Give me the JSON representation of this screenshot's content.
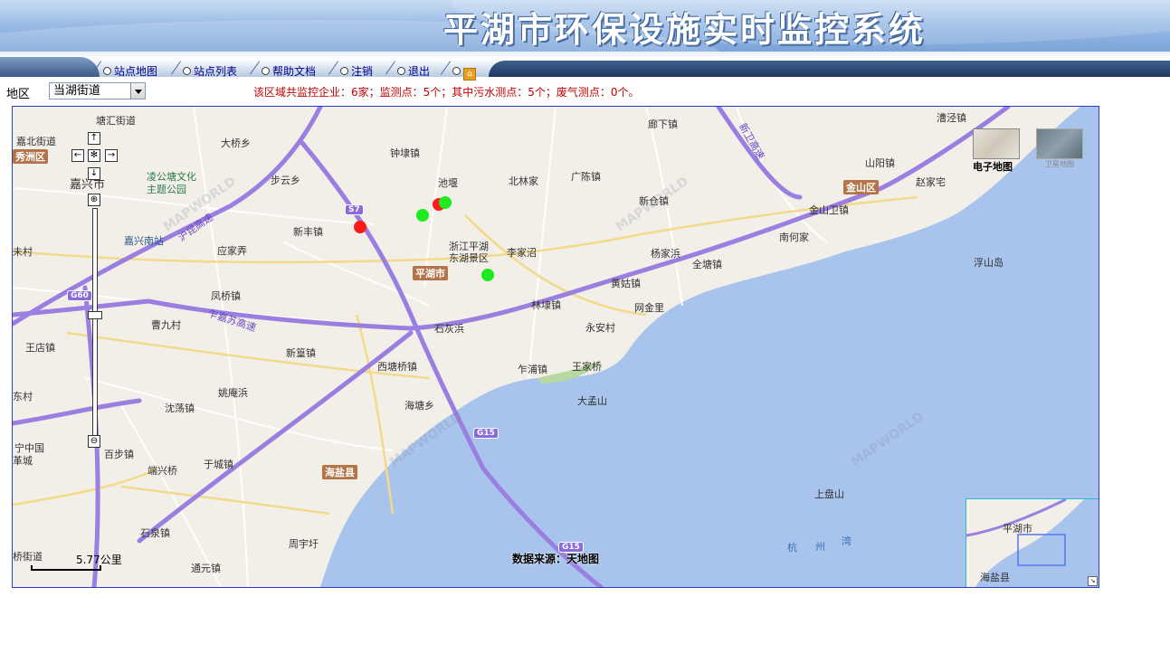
{
  "header": {
    "title": "平湖市环保设施实时监控系统"
  },
  "nav": {
    "items": [
      {
        "label": "站点地图"
      },
      {
        "label": "站点列表"
      },
      {
        "label": "帮助文档"
      },
      {
        "label": "注销"
      },
      {
        "label": "退出"
      }
    ]
  },
  "filter": {
    "region_label": "地区",
    "region_value": "当湖街道",
    "summary": "该区域共监控企业：6家；监测点：5个；其中污水测点：5个；废气测点：0个。"
  },
  "map": {
    "maptype_electronic": "电子地图",
    "maptype_satellite": "卫星地图",
    "scale": "5.77公里",
    "source": "数据来源：天地图",
    "stations": [
      {
        "status": "alarm",
        "color": "#ff1a1a"
      },
      {
        "status": "normal",
        "color": "#1eea1e"
      },
      {
        "status": "alarm",
        "color": "#ff1a1a"
      },
      {
        "status": "normal",
        "color": "#1eea1e"
      },
      {
        "status": "normal",
        "color": "#1eea1e"
      }
    ],
    "place_labels": [
      "塘汇街道",
      "嘉北街道",
      "秀洲区",
      "大桥乡",
      "凌公塘文化",
      "主题公园",
      "嘉兴南站",
      "嘉兴市",
      "步云乡",
      "新丰镇",
      "应家弄",
      "凤桥镇",
      "曹九村",
      "王店镇",
      "新篁镇",
      "沈荡镇",
      "姚庵浜",
      "西塘桥镇",
      "百步镇",
      "端兴桥",
      "于城镇",
      "石泉镇",
      "周宇圩",
      "通元镇",
      "宁中国",
      "革城",
      "海塘乡",
      "钟埭镇",
      "池堰",
      "北林家",
      "广陈镇",
      "廊下镇",
      "新仓镇",
      "山阳镇",
      "赵家宅",
      "漕泾镇",
      "金山卫镇",
      "南何家",
      "杨家浜",
      "全塘镇",
      "浙江平湖",
      "东湖景区",
      "李家沼",
      "黄姑镇",
      "林埭镇",
      "网金里",
      "永安村",
      "石灰浜",
      "乍浦镇",
      "王家桥",
      "大孟山",
      "上盘山",
      "浮山岛",
      "杭",
      "州",
      "湾",
      "未村",
      "东村",
      "桥街道"
    ],
    "district_badges": [
      "平湖市",
      "金山区",
      "海盐县",
      "秀洲区"
    ],
    "highways": [
      "S7",
      "G60",
      "G15",
      "G15"
    ],
    "road_names": [
      "沪昆高速",
      "乍嘉苏高速",
      "新卫高速"
    ],
    "overview_labels": [
      "平湖市",
      "海盐县"
    ]
  }
}
